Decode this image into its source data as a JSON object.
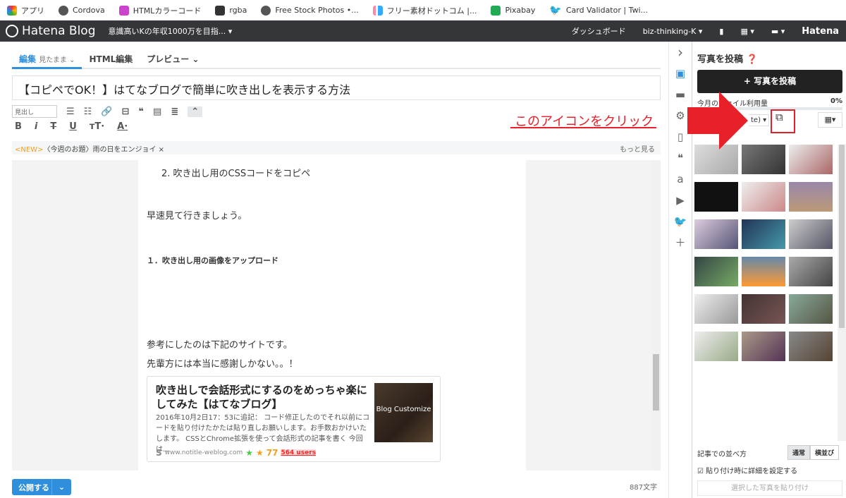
{
  "bookmarks": [
    "アプリ",
    "Cordova",
    "HTMLカラーコード",
    "rgba",
    "Free Stock Photos •...",
    "フリー素材ドットコム |...",
    "Pixabay",
    "Card Validator | Twi..."
  ],
  "header": {
    "logo": "Hatena Blog",
    "blog_name": "意識高いKの年収1000万を目指... ▾",
    "dashboard": "ダッシュボード",
    "user": "biz-thinking-K ▾",
    "hatena": "Hatena"
  },
  "tabs": {
    "edit": "編集",
    "edit_mode": "見たまま ⌄",
    "html": "HTML編集",
    "preview": "プレビュー ⌄"
  },
  "title": "【コピペでOK！】はてなブログで簡単に吹き出しを表示する方法",
  "toolbar": {
    "heading_select": "見出し"
  },
  "topic": {
    "new": "<NEW>",
    "text": "〈今週のお題〉雨の日をエンジョイ ×",
    "more": "もっと見る"
  },
  "content": {
    "list_item": "2. 吹き出し用のCSSコードをコピペ",
    "p1": "早速見て行きましょう。",
    "h": "１．吹き出し用の画像をアップロード",
    "p2": "参考にしたのは下記のサイトです。",
    "p3": "先輩方には本当に感謝しかない。。！",
    "card": {
      "title": "吹き出しで会話形式にするのをめっちゃ楽にしてみた【はてなブログ】",
      "desc": "2016年10月2日17：53に追記： コード修正したのでそれ以前にコードを貼り付けたかたは貼り直しお願いします。お手数おかけいたします。 CSSとChrome拡張を使って会話形式の記事を書く 今回は...",
      "image_text": "Blog Customize",
      "site": "www.notitle-weblog.com",
      "stars": "77",
      "users": "564 users"
    }
  },
  "footer": {
    "publish": "公開する",
    "char_count": "887文字"
  },
  "panel": {
    "title": "写真を投稿",
    "upload": "+ 写真を投稿",
    "usage_label": "今月のファイル利用量",
    "usage_value": "0%",
    "usage_fraction": 0,
    "source_partial": "te) ▾",
    "sort_label": "記事での並べ方",
    "sort_normal": "通常",
    "sort_side": "横並び",
    "detail_checkbox": "貼り付け時に詳細を設定する",
    "paste": "選択した写真を貼り付け"
  },
  "annotation": {
    "text": "このアイコンをクリック",
    "color": "#e8202a"
  },
  "colors": {
    "accent": "#2f8fdc",
    "header_bg": "#35363a"
  }
}
